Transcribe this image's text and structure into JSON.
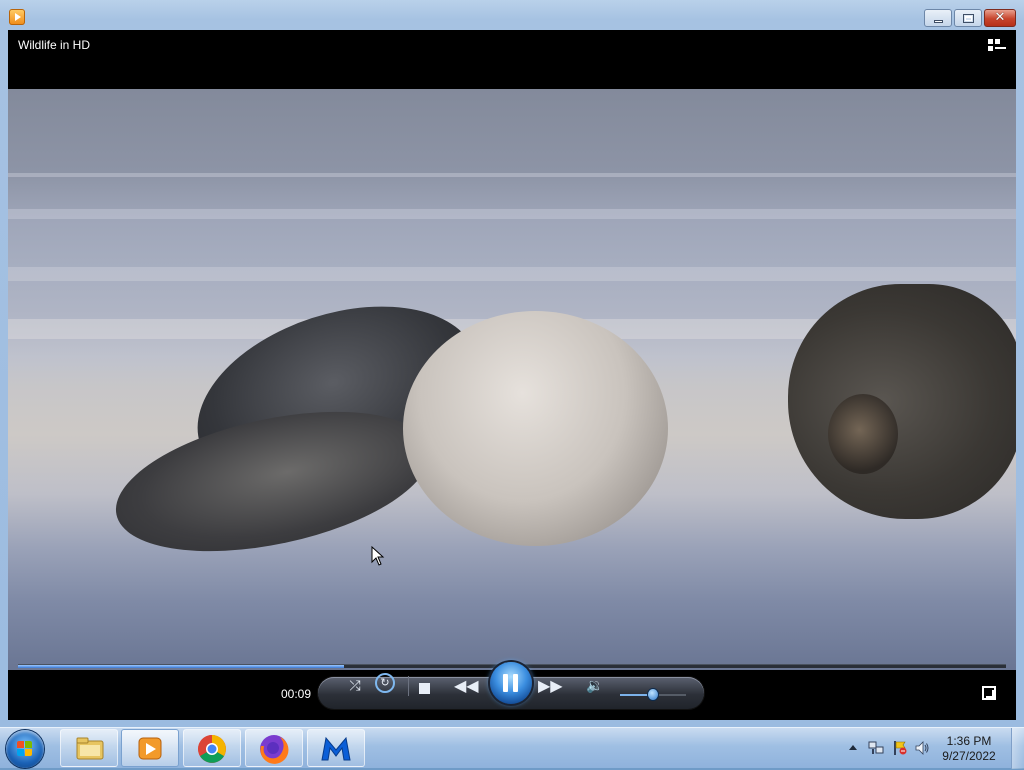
{
  "window": {
    "title": "Wildlife in HD"
  },
  "player": {
    "elapsed": "00:09",
    "progress_fraction": 0.33,
    "volume_fraction": 0.5,
    "state": "playing"
  },
  "taskbar": {
    "apps": [
      {
        "name": "windows-explorer-icon"
      },
      {
        "name": "windows-media-player-icon",
        "active": true
      },
      {
        "name": "chrome-icon"
      },
      {
        "name": "firefox-icon"
      },
      {
        "name": "malwarebytes-icon"
      }
    ],
    "clock_time": "1:36 PM",
    "clock_date": "9/27/2022"
  },
  "colors": {
    "accent": "#3b8ee0",
    "close_button": "#c7442c"
  }
}
